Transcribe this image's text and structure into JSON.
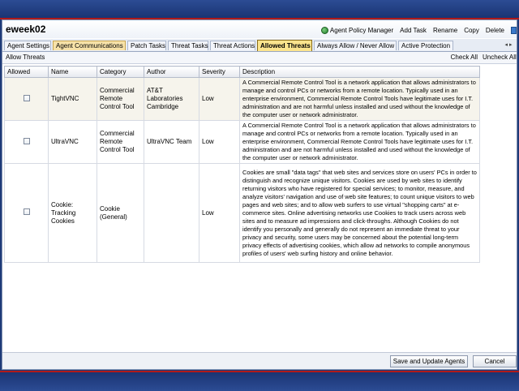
{
  "window": {
    "title": "eweek02"
  },
  "actions": [
    {
      "label": "Agent Policy Manager",
      "icon": "globe-icon"
    },
    {
      "label": "Add Task"
    },
    {
      "label": "Rename"
    },
    {
      "label": "Copy"
    },
    {
      "label": "Delete"
    }
  ],
  "tabs": [
    {
      "label": "Agent Settings",
      "state": "normal"
    },
    {
      "label": "Agent Communications",
      "state": "warm"
    },
    {
      "label": "Patch Tasks",
      "state": "normal"
    },
    {
      "label": "Threat Tasks",
      "state": "normal"
    },
    {
      "label": "Threat Actions",
      "state": "normal"
    },
    {
      "label": "Allowed Threats",
      "state": "active"
    },
    {
      "label": "Always Allow / Never Allow",
      "state": "normal"
    },
    {
      "label": "Active Protection",
      "state": "normal"
    }
  ],
  "toolbar": {
    "label": "Allow Threats",
    "check_all": "Check All",
    "uncheck_all": "Uncheck All"
  },
  "table": {
    "headers": {
      "allowed": "Allowed",
      "name": "Name",
      "category": "Category",
      "author": "Author",
      "severity": "Severity",
      "description": "Description"
    },
    "rows": [
      {
        "allowed": false,
        "name": "TightVNC",
        "category": "Commercial Remote Control Tool",
        "author": "AT&T Laboratories Cambridge",
        "severity": "Low",
        "description": "A Commercial Remote Control Tool is a network application that allows administrators to manage and control PCs or networks from a remote location. Typically used in an enterprise environment, Commercial Remote Control Tools have legitimate uses for I.T. administration and are not harmful unless installed and used without the knowledge of the computer user or network administrator."
      },
      {
        "allowed": false,
        "name": "UltraVNC",
        "category": "Commercial Remote Control Tool",
        "author": "UltraVNC Team",
        "severity": "Low",
        "description": "A Commercial Remote Control Tool is a network application that allows administrators to manage and control PCs or networks from a remote location. Typically used in an enterprise environment, Commercial Remote Control Tools have legitimate uses for I.T. administration and are not harmful unless installed and used without the knowledge of the computer user or network administrator."
      },
      {
        "allowed": false,
        "name": "Cookie: Tracking Cookies",
        "category": "Cookie (General)",
        "author": "",
        "severity": "Low",
        "description": "Cookies are small \"data tags\" that web sites and services store on users' PCs in order to distinguish and recognize unique visitors. Cookies are used by web sites to identify returning visitors who have registered for special services; to monitor, measure, and analyze visitors' navigation and use of web site features; to count unique visitors to web pages and web sites; and to allow web surfers to use virtual \"shopping carts\" at e-commerce sites. Online advertising networks use Cookies to track users across web sites and to measure ad impressions and click-throughs. Although Cookies do not identify you personally and generally do not represent an immediate threat to your privacy and security, some users may be concerned about the potential long-term privacy effects of advertising cookies, which allow ad networks to compile anonymous profiles of users' web surfing history and online behavior."
      }
    ]
  },
  "footer": {
    "save_label": "Save and Update Agents",
    "cancel_label": "Cancel"
  },
  "colors": {
    "frame": "#1e3a78",
    "frame_accent": "#b01a1a",
    "active_tab": "#fbe48d",
    "row_shade": "#f6f4ec"
  }
}
